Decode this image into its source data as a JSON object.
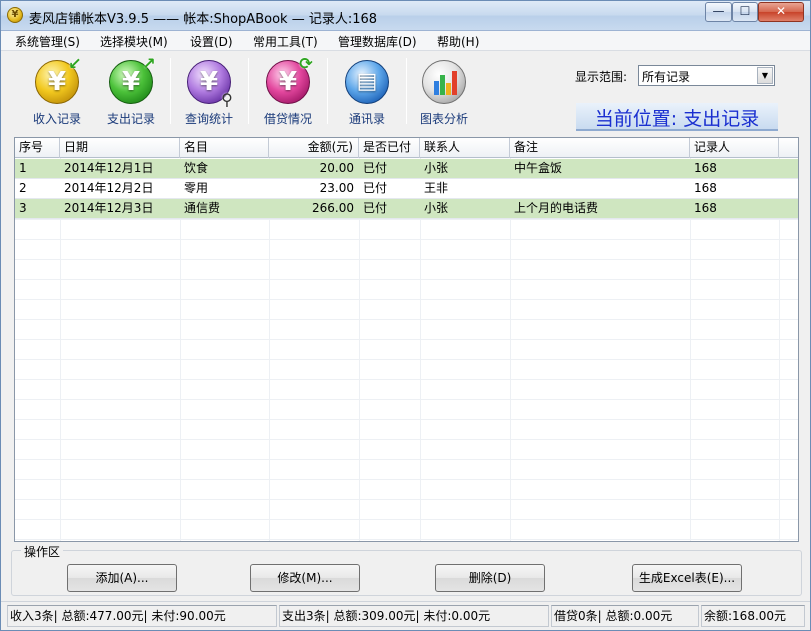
{
  "window": {
    "title": "麦风店铺帐本V3.9.5  ——  帐本:ShopABook — 记录人:168",
    "min_glyph": "—",
    "max_glyph": "☐",
    "close_glyph": "✕"
  },
  "menu": [
    {
      "label": "系统管理(S)"
    },
    {
      "label": "选择模块(M)"
    },
    {
      "label": "设置(D)"
    },
    {
      "label": "常用工具(T)"
    },
    {
      "label": "管理数据库(D)"
    },
    {
      "label": "帮助(H)"
    }
  ],
  "toolbar": {
    "items": [
      {
        "label": "收入记录",
        "icon": "income-icon"
      },
      {
        "label": "支出记录",
        "icon": "expense-icon"
      },
      {
        "label": "查询统计",
        "icon": "query-icon"
      },
      {
        "label": "借贷情况",
        "icon": "loan-icon"
      },
      {
        "label": "通讯录",
        "icon": "contacts-icon"
      },
      {
        "label": "图表分析",
        "icon": "chart-icon"
      }
    ],
    "range_label": "显示范围:",
    "range_value": "所有记录",
    "position_text": "当前位置: 支出记录"
  },
  "table": {
    "columns": [
      "序号",
      "日期",
      "名目",
      "金额(元)",
      "是否已付",
      "联系人",
      "备注",
      "记录人"
    ],
    "rows": [
      [
        "1",
        "2014年12月1日",
        "饮食",
        "20.00",
        "已付",
        "小张",
        "中午盒饭",
        "168"
      ],
      [
        "2",
        "2014年12月2日",
        "零用",
        "23.00",
        "已付",
        "王非",
        "",
        "168"
      ],
      [
        "3",
        "2014年12月3日",
        "通信费",
        "266.00",
        "已付",
        "小张",
        "上个月的电话费",
        "168"
      ]
    ],
    "row_highlight_color": "#cfe6c0"
  },
  "ops": {
    "label": "操作区",
    "add": "添加(A)...",
    "edit": "修改(M)...",
    "delete": "删除(D)",
    "excel": "生成Excel表(E)..."
  },
  "status": {
    "income": "收入3条| 总额:477.00元| 未付:90.00元",
    "expense": "支出3条| 总额:309.00元| 未付:0.00元",
    "loan": "借贷0条| 总额:0.00元",
    "balance": "余额:168.00元"
  }
}
